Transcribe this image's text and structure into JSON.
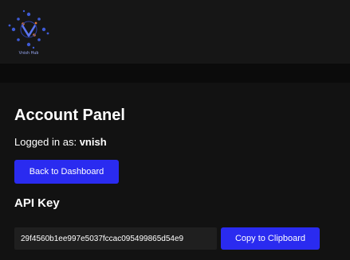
{
  "header": {
    "logo_text": "Vnish Hub"
  },
  "account": {
    "title": "Account Panel",
    "logged_in_label": "Logged in as: ",
    "username": "vnish",
    "back_button_label": "Back to Dashboard"
  },
  "api": {
    "title": "API Key",
    "key_value": "29f4560b1ee997e5037fccac095499865d54e9",
    "copy_button_label": "Copy to Clipboard"
  },
  "colors": {
    "background": "#121212",
    "primary_button": "#2a2bf0",
    "input_background": "#1f1f1f"
  }
}
